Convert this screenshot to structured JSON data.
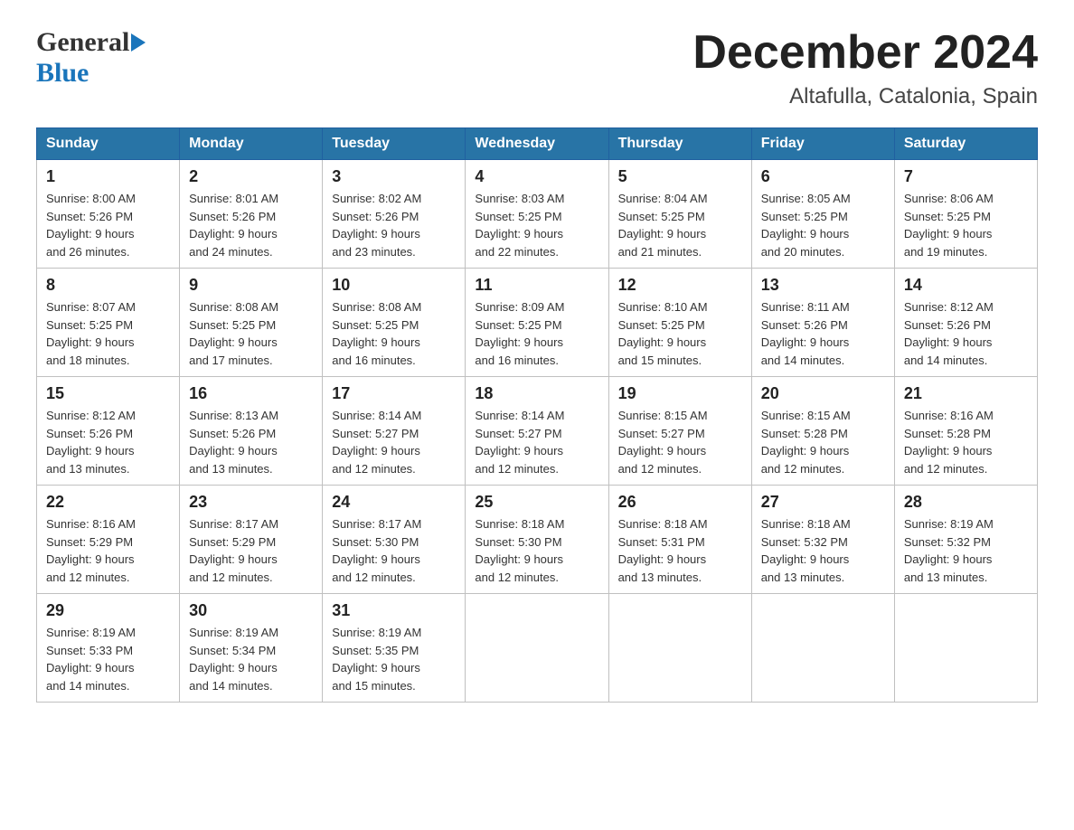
{
  "header": {
    "logo_general": "General",
    "logo_blue": "Blue",
    "month_title": "December 2024",
    "location": "Altafulla, Catalonia, Spain"
  },
  "days_of_week": [
    "Sunday",
    "Monday",
    "Tuesday",
    "Wednesday",
    "Thursday",
    "Friday",
    "Saturday"
  ],
  "weeks": [
    {
      "days": [
        {
          "number": "1",
          "sunrise": "8:00 AM",
          "sunset": "5:26 PM",
          "daylight": "9 hours and 26 minutes."
        },
        {
          "number": "2",
          "sunrise": "8:01 AM",
          "sunset": "5:26 PM",
          "daylight": "9 hours and 24 minutes."
        },
        {
          "number": "3",
          "sunrise": "8:02 AM",
          "sunset": "5:26 PM",
          "daylight": "9 hours and 23 minutes."
        },
        {
          "number": "4",
          "sunrise": "8:03 AM",
          "sunset": "5:25 PM",
          "daylight": "9 hours and 22 minutes."
        },
        {
          "number": "5",
          "sunrise": "8:04 AM",
          "sunset": "5:25 PM",
          "daylight": "9 hours and 21 minutes."
        },
        {
          "number": "6",
          "sunrise": "8:05 AM",
          "sunset": "5:25 PM",
          "daylight": "9 hours and 20 minutes."
        },
        {
          "number": "7",
          "sunrise": "8:06 AM",
          "sunset": "5:25 PM",
          "daylight": "9 hours and 19 minutes."
        }
      ]
    },
    {
      "days": [
        {
          "number": "8",
          "sunrise": "8:07 AM",
          "sunset": "5:25 PM",
          "daylight": "9 hours and 18 minutes."
        },
        {
          "number": "9",
          "sunrise": "8:08 AM",
          "sunset": "5:25 PM",
          "daylight": "9 hours and 17 minutes."
        },
        {
          "number": "10",
          "sunrise": "8:08 AM",
          "sunset": "5:25 PM",
          "daylight": "9 hours and 16 minutes."
        },
        {
          "number": "11",
          "sunrise": "8:09 AM",
          "sunset": "5:25 PM",
          "daylight": "9 hours and 16 minutes."
        },
        {
          "number": "12",
          "sunrise": "8:10 AM",
          "sunset": "5:25 PM",
          "daylight": "9 hours and 15 minutes."
        },
        {
          "number": "13",
          "sunrise": "8:11 AM",
          "sunset": "5:26 PM",
          "daylight": "9 hours and 14 minutes."
        },
        {
          "number": "14",
          "sunrise": "8:12 AM",
          "sunset": "5:26 PM",
          "daylight": "9 hours and 14 minutes."
        }
      ]
    },
    {
      "days": [
        {
          "number": "15",
          "sunrise": "8:12 AM",
          "sunset": "5:26 PM",
          "daylight": "9 hours and 13 minutes."
        },
        {
          "number": "16",
          "sunrise": "8:13 AM",
          "sunset": "5:26 PM",
          "daylight": "9 hours and 13 minutes."
        },
        {
          "number": "17",
          "sunrise": "8:14 AM",
          "sunset": "5:27 PM",
          "daylight": "9 hours and 12 minutes."
        },
        {
          "number": "18",
          "sunrise": "8:14 AM",
          "sunset": "5:27 PM",
          "daylight": "9 hours and 12 minutes."
        },
        {
          "number": "19",
          "sunrise": "8:15 AM",
          "sunset": "5:27 PM",
          "daylight": "9 hours and 12 minutes."
        },
        {
          "number": "20",
          "sunrise": "8:15 AM",
          "sunset": "5:28 PM",
          "daylight": "9 hours and 12 minutes."
        },
        {
          "number": "21",
          "sunrise": "8:16 AM",
          "sunset": "5:28 PM",
          "daylight": "9 hours and 12 minutes."
        }
      ]
    },
    {
      "days": [
        {
          "number": "22",
          "sunrise": "8:16 AM",
          "sunset": "5:29 PM",
          "daylight": "9 hours and 12 minutes."
        },
        {
          "number": "23",
          "sunrise": "8:17 AM",
          "sunset": "5:29 PM",
          "daylight": "9 hours and 12 minutes."
        },
        {
          "number": "24",
          "sunrise": "8:17 AM",
          "sunset": "5:30 PM",
          "daylight": "9 hours and 12 minutes."
        },
        {
          "number": "25",
          "sunrise": "8:18 AM",
          "sunset": "5:30 PM",
          "daylight": "9 hours and 12 minutes."
        },
        {
          "number": "26",
          "sunrise": "8:18 AM",
          "sunset": "5:31 PM",
          "daylight": "9 hours and 13 minutes."
        },
        {
          "number": "27",
          "sunrise": "8:18 AM",
          "sunset": "5:32 PM",
          "daylight": "9 hours and 13 minutes."
        },
        {
          "number": "28",
          "sunrise": "8:19 AM",
          "sunset": "5:32 PM",
          "daylight": "9 hours and 13 minutes."
        }
      ]
    },
    {
      "days": [
        {
          "number": "29",
          "sunrise": "8:19 AM",
          "sunset": "5:33 PM",
          "daylight": "9 hours and 14 minutes."
        },
        {
          "number": "30",
          "sunrise": "8:19 AM",
          "sunset": "5:34 PM",
          "daylight": "9 hours and 14 minutes."
        },
        {
          "number": "31",
          "sunrise": "8:19 AM",
          "sunset": "5:35 PM",
          "daylight": "9 hours and 15 minutes."
        },
        null,
        null,
        null,
        null
      ]
    }
  ],
  "labels": {
    "sunrise_prefix": "Sunrise: ",
    "sunset_prefix": "Sunset: ",
    "daylight_prefix": "Daylight: "
  }
}
